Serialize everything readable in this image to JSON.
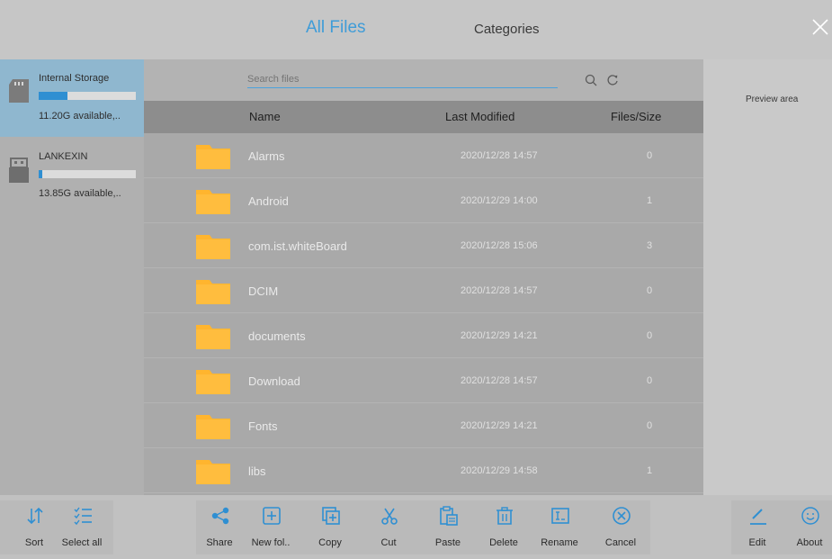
{
  "header": {
    "tabs": [
      {
        "label": "All Files"
      },
      {
        "label": "Categories"
      }
    ]
  },
  "storage": [
    {
      "name": "Internal Storage",
      "available": "11.20G available,..",
      "used_fraction": 0.3
    },
    {
      "name": "LANKEXIN",
      "available": "13.85G available,..",
      "used_fraction": 0.04
    }
  ],
  "search": {
    "placeholder": "Search files"
  },
  "columns": {
    "name": "Name",
    "modified": "Last Modified",
    "size": "Files/Size"
  },
  "files": [
    {
      "name": "Alarms",
      "modified": "2020/12/28 14:57",
      "count": "0"
    },
    {
      "name": "Android",
      "modified": "2020/12/29 14:00",
      "count": "1"
    },
    {
      "name": "com.ist.whiteBoard",
      "modified": "2020/12/28 15:06",
      "count": "3"
    },
    {
      "name": "DCIM",
      "modified": "2020/12/28 14:57",
      "count": "0"
    },
    {
      "name": "documents",
      "modified": "2020/12/29 14:21",
      "count": "0"
    },
    {
      "name": "Download",
      "modified": "2020/12/28 14:57",
      "count": "0"
    },
    {
      "name": "Fonts",
      "modified": "2020/12/29 14:21",
      "count": "0"
    },
    {
      "name": "libs",
      "modified": "2020/12/29 14:58",
      "count": "1"
    }
  ],
  "preview": {
    "label": "Preview area"
  },
  "toolbar": {
    "sort": "Sort",
    "select_all": "Select all",
    "share": "Share",
    "new_folder": "New fol..",
    "copy": "Copy",
    "cut": "Cut",
    "paste": "Paste",
    "delete": "Delete",
    "rename": "Rename",
    "cancel": "Cancel",
    "edit": "Edit",
    "about": "About"
  },
  "colors": {
    "accent": "#3f9cd8",
    "folder": "#ffb52e",
    "selected_storage": "#8fb7cf"
  }
}
